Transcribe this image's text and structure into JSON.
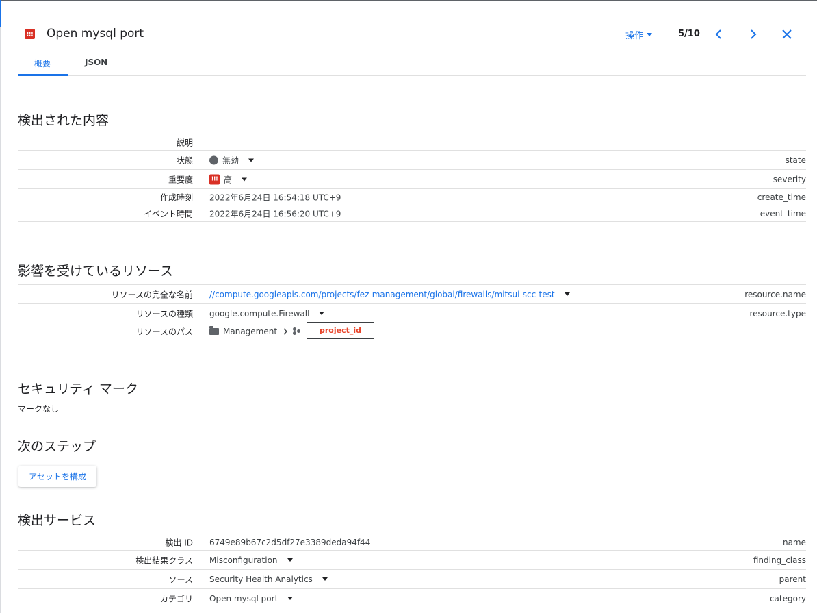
{
  "header": {
    "title": "Open mysql port",
    "actions_label": "操作",
    "pager": "5/10"
  },
  "tabs": [
    {
      "label": "概要",
      "active": true
    },
    {
      "label": "JSON",
      "active": false
    }
  ],
  "detected": {
    "title": "検出された内容",
    "rows": [
      {
        "label": "説明",
        "value": "",
        "key": ""
      },
      {
        "label": "状態",
        "value": "無効",
        "key": "state"
      },
      {
        "label": "重要度",
        "value": "高",
        "key": "severity"
      },
      {
        "label": "作成時刻",
        "value": "2022年6月24日 16:54:18 UTC+9",
        "key": "create_time"
      },
      {
        "label": "イベント時間",
        "value": "2022年6月24日 16:56:20 UTC+9",
        "key": "event_time"
      }
    ]
  },
  "resources": {
    "title": "影響を受けているリソース",
    "rows": [
      {
        "label": "リソースの完全な名前",
        "value": "//compute.googleapis.com/projects/fez-management/global/firewalls/mitsui-scc-test",
        "key": "resource.name"
      },
      {
        "label": "リソースの種類",
        "value": "google.compute.Firewall",
        "key": "resource.type"
      },
      {
        "label": "リソースのパス",
        "value": "Management",
        "key": ""
      }
    ],
    "redaction_label": "project_id"
  },
  "security_marks": {
    "title": "セキュリティ マーク",
    "empty_text": "マークなし"
  },
  "next_steps": {
    "title": "次のステップ",
    "button_label": "アセットを構成"
  },
  "service": {
    "title": "検出サービス",
    "rows": [
      {
        "label": "検出 ID",
        "value": "6749e89b67c2d5df27e3389deda94f44",
        "key": "name"
      },
      {
        "label": "検出結果クラス",
        "value": "Misconfiguration",
        "key": "finding_class"
      },
      {
        "label": "ソース",
        "value": "Security Health Analytics",
        "key": "parent"
      },
      {
        "label": "カテゴリ",
        "value": "Open mysql port",
        "key": "category"
      }
    ]
  },
  "colors": {
    "accent": "#1a73e8",
    "severity_high": "#d93025",
    "redaction_text": "#e8442a"
  }
}
